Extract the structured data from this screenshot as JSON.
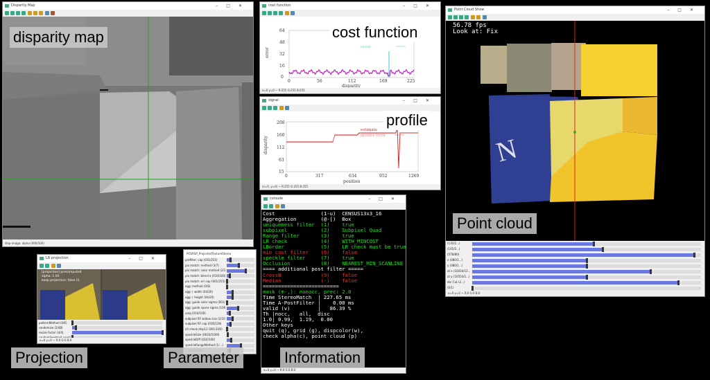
{
  "labels": {
    "disparity": "disparity map",
    "cost": "cost function",
    "profile": "profile",
    "pointcloud": "Point cloud",
    "projection": "Projection",
    "parameter": "Parameter",
    "information": "Information"
  },
  "windows": {
    "disparity": {
      "title": "Disparity Map",
      "status": "disp-image: alpha (000/100)"
    },
    "cost": {
      "title": "cost function",
      "status": "x=0 y=0 ~ R:255 G:255 B:255"
    },
    "signal": {
      "title": "signal",
      "status": "(x=0, y=0) ~ R:255 G:255 B:255"
    },
    "pointcloud": {
      "title": "Point Cloud Show",
      "fps": "56.78 fps",
      "lookat": "Look at: Fix",
      "status": "x=0 y=0 ~ R:0 G:0 B:0"
    },
    "projection": {
      "title": "LR projection",
      "status": "x=0 y=0 ~ R:0 G:0 B:0",
      "overlay": [
        "[projection] precomputed",
        "alpha: 1.00",
        "keep projection: false (l)"
      ]
    },
    "parameter": {
      "title": "POSRSP_ProjectedTextureStereo"
    },
    "console": {
      "title": "console",
      "status": "x=0 y=0 ~ R:0 G:0 B:0"
    }
  },
  "cost_chart": {
    "ylabel": "error",
    "xlabel": "disparity",
    "yticks": [
      "64",
      "48",
      "32",
      "16",
      "0"
    ],
    "xticks": [
      "0",
      "56",
      "112",
      "169",
      "225"
    ],
    "legend": [
      "min cost",
      "result"
    ]
  },
  "signal_chart": {
    "ylabel": "disparity",
    "xlabel": "position",
    "yticks": [
      "208",
      "160",
      "112",
      "63",
      "15"
    ],
    "xticks": [
      "0",
      "317",
      "634",
      "952",
      "1269"
    ],
    "legend": [
      "estimate",
      "ground truth"
    ]
  },
  "projection_sliders": [
    {
      "label": "patternMethod (0/6)",
      "pct": 0
    },
    {
      "label": "randomize (2/48)",
      "pct": 4
    },
    {
      "label": "resize factor (4/4)",
      "pct": 100
    },
    {
      "label": "randomSeed(not used) (0/80)",
      "pct": 0
    }
  ],
  "parameter_sliders": [
    {
      "label": "prefilter: cap (031/255)",
      "pct": 12
    },
    {
      "label": "pix match: method (3/7)",
      "pct": 43
    },
    {
      "label": "pix match: color method (2/3)",
      "pct": 67
    },
    {
      "label": "pix match: blend a (010/100)",
      "pct": 10
    },
    {
      "label": "pix match: err cap (001/255)",
      "pct": 1
    },
    {
      "label": "agg: method (0/6)",
      "pct": 0
    },
    {
      "label": "agg: r width (04/20)",
      "pct": 20
    },
    {
      "label": "agg: r height (04/20)",
      "pct": 20
    },
    {
      "label": "agg: guide color sigma (001/255)",
      "pct": 1
    },
    {
      "label": "agg: guide space sigma (100/255)",
      "pct": 39
    },
    {
      "label": "uniq (010/100)",
      "pct": 10
    },
    {
      "label": "subpixel RF widow size (2/10)",
      "pct": 20
    },
    {
      "label": "subpixel RF cap (016/128)",
      "pct": 13
    },
    {
      "label": "LR check disp12 (001/100)",
      "pct": 1
    },
    {
      "label": "speckleSize (0020/1000)",
      "pct": 2
    },
    {
      "label": "speckleDiff (016/100)",
      "pct": 16
    },
    {
      "label": "speckleRangeMethod (1/...)",
      "pct": 50
    },
    {
      "label": "... (010/100)",
      "pct": 10
    }
  ],
  "pointcloud_sliders": [
    {
      "label": "(135/2...)",
      "pct": 53
    },
    {
      "label": "(145/2...)",
      "pct": 57
    },
    {
      "label": "(078/80)",
      "pct": 97
    },
    {
      "label": "x (080/1...)",
      "pct": 50
    },
    {
      "label": "y (080/1...)",
      "pct": 50
    },
    {
      "label": "at x (10034/12...)",
      "pct": 78
    },
    {
      "label": "at y (10554/1...)",
      "pct": 50
    },
    {
      "label": "der Cut (2...)",
      "pct": 90
    },
    {
      "label": "(0/1)",
      "pct": 0
    }
  ],
  "console_lines": [
    {
      "text": "Cost               (1-u)  CENSUS13x3_16",
      "color": "w"
    },
    {
      "text": "Aggregation        (@-[)  Box",
      "color": "w"
    },
    {
      "text": "uniqueness filter  (1)    true",
      "color": "g"
    },
    {
      "text": "subpixel           (2)    Subpixel Quad",
      "color": "g"
    },
    {
      "text": "Range filter       (3)    true",
      "color": "g"
    },
    {
      "text": "LR check           (4)    WITH_MINCOST",
      "color": "g"
    },
    {
      "text": "LBorder            (5)    LR check must be true: f",
      "color": "g"
    },
    {
      "text": "min cost filter    (6)    false",
      "color": "r"
    },
    {
      "text": "speckle filter     (7)    true",
      "color": "g"
    },
    {
      "text": "Occlusion          (8)    NEAREST_MIN_SCANLINE",
      "color": "g"
    },
    {
      "text": "==== additional post filter =====",
      "color": "w"
    },
    {
      "text": "CrossB             (9)    false",
      "color": "r"
    },
    {
      "text": "Median             (-)    false",
      "color": "r"
    },
    {
      "text": "=========================",
      "color": "w"
    },
    {
      "text": "mask (m-,): nonocc, prec: 2.0",
      "color": "g"
    },
    {
      "text": "Time StereoMatch  | 227.65 ms",
      "color": "w"
    },
    {
      "text": "Time A-PostFilter |    0.00 ms",
      "color": "w"
    },
    {
      "text": "valid (v)         |   86.39 %",
      "color": "w"
    },
    {
      "text": "Th |nocc,   all,  disc",
      "color": "w"
    },
    {
      "text": "1.0| 0.99,  1.19,  0.00",
      "color": "w"
    },
    {
      "text": "Other keys",
      "color": "w"
    },
    {
      "text": "quit (q), grid (g), dispcolor(w),",
      "color": "w"
    },
    {
      "text": "check alpha(c), point cloud (p)",
      "color": "w"
    }
  ]
}
